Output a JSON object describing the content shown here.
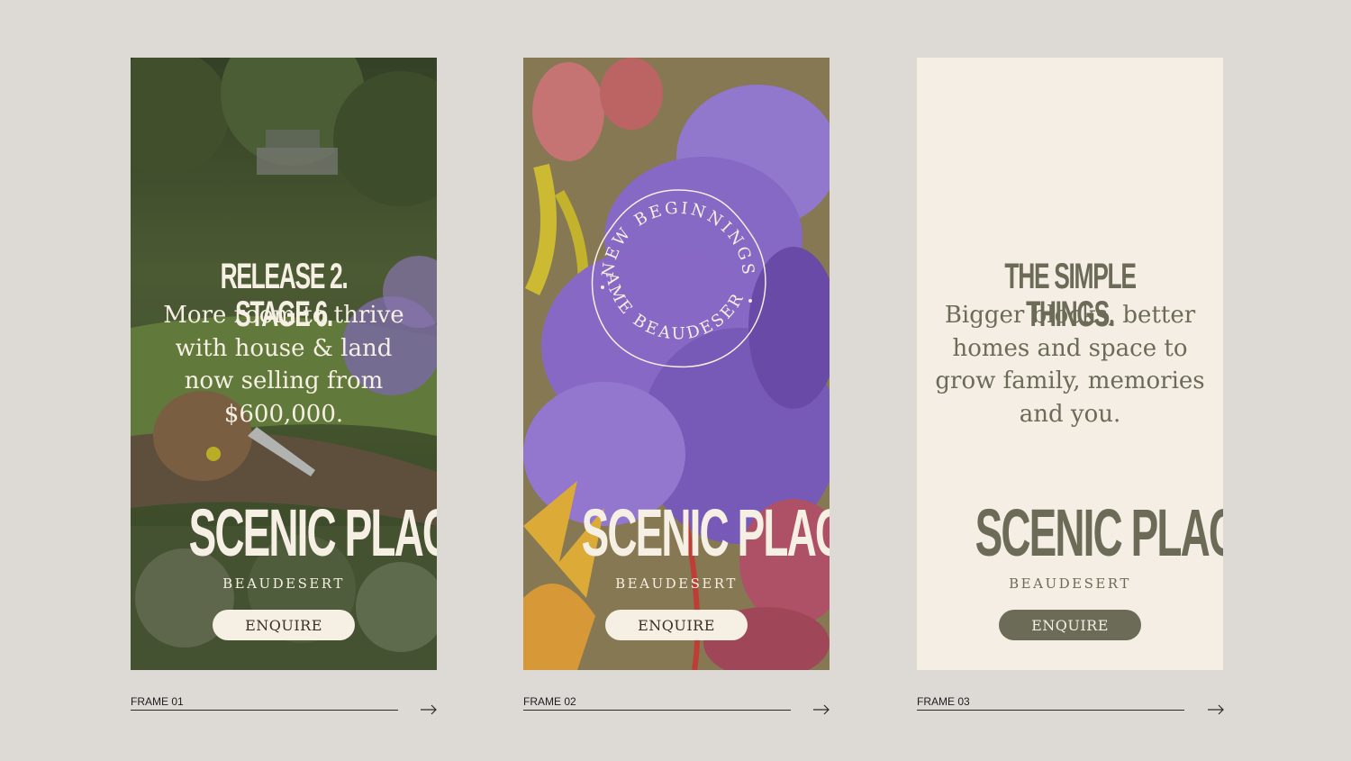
{
  "frames": [
    {
      "headline": "RELEASE 2. STAGE 6.",
      "body_lines": [
        "More room to thrive",
        "with house & land",
        "now selling from",
        "$600,000."
      ],
      "brand": "SCENIC PLACE",
      "subbrand": "BEAUDESERT",
      "cta": "ENQUIRE",
      "caption": "FRAME 01",
      "image": "aerial-park-playground"
    },
    {
      "badge_top": "NEW BEGINNINGS",
      "badge_bottom": "SAME BEAUDESERT",
      "brand": "SCENIC PLACE",
      "subbrand": "BEAUDESERT",
      "cta": "ENQUIRE",
      "caption": "FRAME 02",
      "image": "purple-flowers"
    },
    {
      "headline": "THE SIMPLE THINGS.",
      "body_lines": [
        "Bigger blocks, better",
        "homes and space to",
        "grow family, memories",
        "and you."
      ],
      "brand": "SCENIC PLACE",
      "subbrand": "BEAUDESERT",
      "cta": "ENQUIRE",
      "caption": "FRAME 03"
    }
  ],
  "icons": {
    "next": "arrow-right-icon"
  },
  "colors": {
    "page_bg": "#dddad6",
    "cream": "#f6efe3",
    "olive": "#6b6b57",
    "frame3_bg": "#f4eee4"
  }
}
